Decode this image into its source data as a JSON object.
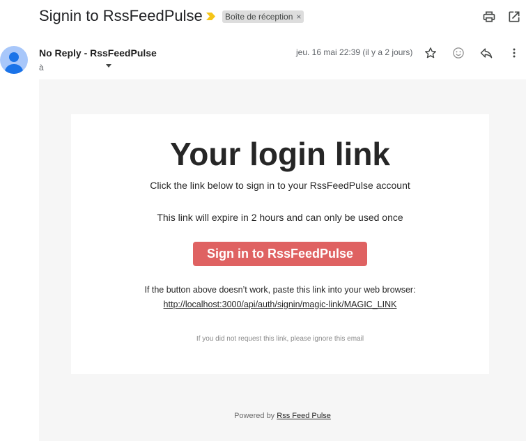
{
  "email": {
    "subject": "Signin to RssFeedPulse",
    "label": "Boîte de réception",
    "label_remove": "×",
    "sender": "No Reply - RssFeedPulse",
    "recipient": "à",
    "date": "jeu. 16 mai 22:39 (il y a 2 jours)"
  },
  "icons": {
    "importance": "importance-marker-icon",
    "print": "print-icon",
    "open_new_window": "open-in-new-window-icon",
    "star": "star-icon",
    "emoji": "emoji-react-icon",
    "reply": "reply-icon",
    "more": "more-vertical-icon",
    "avatar": "person-avatar-icon"
  },
  "colors": {
    "importance": "#f5c518",
    "button": "#df6262",
    "mail_background": "#f6f6f6",
    "avatar": "#a8c7fa"
  },
  "body": {
    "headline": "Your login link",
    "instructions": "Click the link below to sign in to your RssFeedPulse account",
    "expiry_note": "This link will expire in 2 hours and can only be used once",
    "button_label": "Sign in to RssFeedPulse",
    "fallback_text": "If the button above doesn’t work, paste this link into your web browser:",
    "magic_link": "http://localhost:3000/api/auth/signin/magic-link/MAGIC_LINK",
    "ignore_note": "If you did not request this link, please ignore this email"
  },
  "footer": {
    "powered_prefix": "Powered by",
    "powered_link": "Rss Feed Pulse"
  }
}
